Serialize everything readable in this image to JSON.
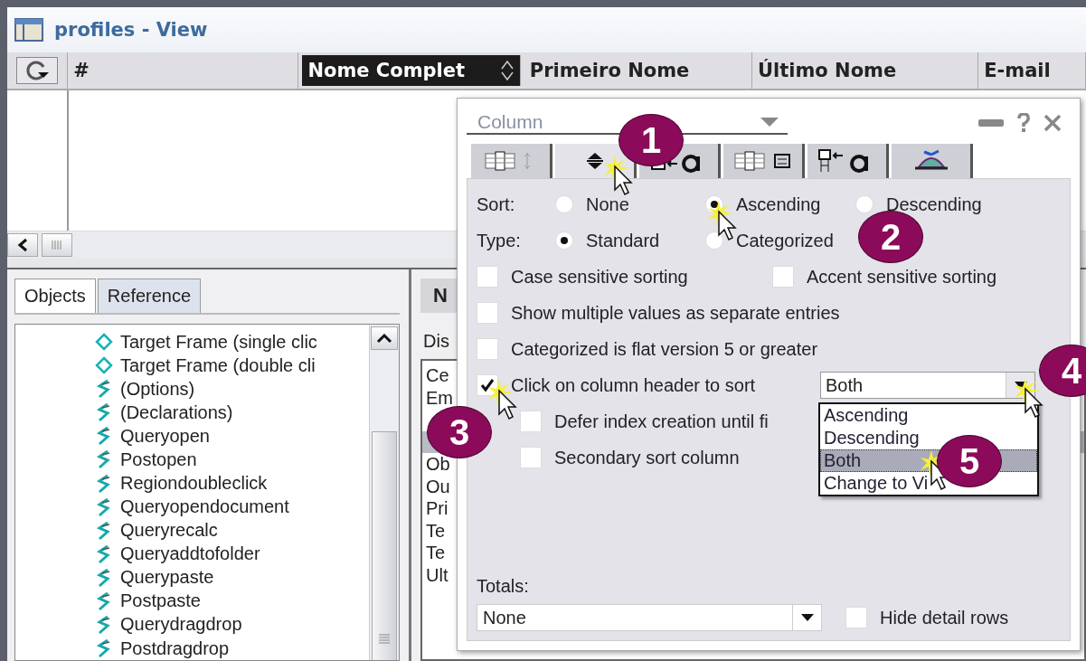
{
  "window": {
    "title": "profiles - View"
  },
  "view_columns": [
    {
      "label": "#",
      "selected": false,
      "sort_arrows": false
    },
    {
      "label": "Nome Complet",
      "selected": true,
      "sort_arrows": true
    },
    {
      "label": "Primeiro Nome",
      "selected": false,
      "sort_arrows": false
    },
    {
      "label": "Último Nome",
      "selected": false,
      "sort_arrows": false
    },
    {
      "label": "E-mail",
      "selected": false,
      "sort_arrows": false
    }
  ],
  "objects_panel": {
    "tabs": [
      {
        "label": "Objects",
        "selected": true
      },
      {
        "label": "Reference",
        "selected": false
      }
    ],
    "items": [
      {
        "label": "Target Frame (single clic",
        "kind": "frame"
      },
      {
        "label": "Target Frame (double cli",
        "kind": "frame"
      },
      {
        "label": "(Options)",
        "kind": "event"
      },
      {
        "label": "(Declarations)",
        "kind": "event"
      },
      {
        "label": "Queryopen",
        "kind": "event"
      },
      {
        "label": "Postopen",
        "kind": "event"
      },
      {
        "label": "Regiondoubleclick",
        "kind": "event"
      },
      {
        "label": "Queryopendocument",
        "kind": "event"
      },
      {
        "label": "Queryrecalc",
        "kind": "event"
      },
      {
        "label": "Queryaddtofolder",
        "kind": "event"
      },
      {
        "label": "Querypaste",
        "kind": "event"
      },
      {
        "label": "Postpaste",
        "kind": "event"
      },
      {
        "label": "Querydragdrop",
        "kind": "event"
      },
      {
        "label": "Postdragdrop",
        "kind": "event"
      }
    ]
  },
  "right_panel": {
    "tab": "N",
    "label": "Dis",
    "rows": [
      {
        "text": "Ce",
        "selected": false
      },
      {
        "text": "Em",
        "selected": false
      },
      {
        "selected": false
      },
      {
        "selected": true
      },
      {
        "text": "Ob",
        "selected": false
      },
      {
        "text": "Ou",
        "selected": false
      },
      {
        "text": "Pri",
        "selected": false
      },
      {
        "text": "Te",
        "selected": false
      },
      {
        "text": "Te",
        "selected": false
      },
      {
        "text": "Ult",
        "selected": false
      }
    ]
  },
  "properties_dialog": {
    "object_type": "Column",
    "tabs": [
      {
        "kind": "info",
        "selected": false
      },
      {
        "kind": "sorting",
        "selected": true
      },
      {
        "kind": "font",
        "selected": false
      },
      {
        "kind": "numbers",
        "selected": false
      },
      {
        "kind": "title-font",
        "selected": false
      },
      {
        "kind": "advanced",
        "selected": false
      }
    ],
    "sort": {
      "label": "Sort:",
      "options": [
        {
          "label": "None",
          "selected": false
        },
        {
          "label": "Ascending",
          "selected": true
        },
        {
          "label": "Descending",
          "selected": false
        }
      ]
    },
    "type": {
      "label": "Type:",
      "options": [
        {
          "label": "Standard",
          "selected": true
        },
        {
          "label": "Categorized",
          "selected": false
        }
      ]
    },
    "sensitivity": [
      {
        "label": "Case sensitive sorting",
        "checked": false
      },
      {
        "label": "Accent sensitive sorting",
        "checked": false
      }
    ],
    "options": [
      {
        "label": "Show multiple values as separate entries",
        "checked": false
      },
      {
        "label": "Categorized is flat version 5 or greater",
        "checked": false
      }
    ],
    "header_sort": {
      "label": "Click on column header to sort",
      "checked": true,
      "value": "Both",
      "open": true,
      "items": [
        {
          "label": "Ascending",
          "selected": false
        },
        {
          "label": "Descending",
          "selected": false
        },
        {
          "label": "Both",
          "selected": true
        },
        {
          "label": "Change to Vi",
          "selected": false
        }
      ]
    },
    "sub_options": [
      {
        "label": "Defer index creation until fi",
        "checked": false
      },
      {
        "label": "Secondary sort column",
        "checked": false
      }
    ],
    "totals": {
      "label": "Totals:",
      "value": "None"
    },
    "hide_detail_rows": {
      "label": "Hide detail rows",
      "checked": false
    }
  },
  "callouts": [
    {
      "number": "1"
    },
    {
      "number": "2"
    },
    {
      "number": "3"
    },
    {
      "number": "4"
    },
    {
      "number": "5"
    }
  ]
}
